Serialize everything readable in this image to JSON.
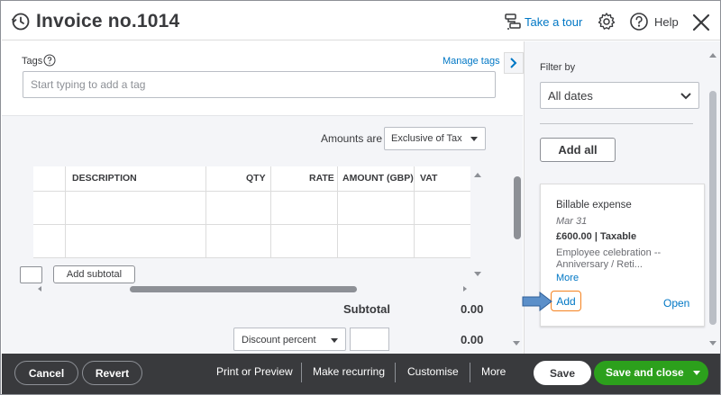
{
  "header": {
    "title": "Invoice no.1014",
    "tour_label": "Take a tour",
    "help_label": "Help"
  },
  "tags": {
    "label": "Tags",
    "manage_label": "Manage tags",
    "placeholder": "Start typing to add a tag"
  },
  "amounts": {
    "label": "Amounts are",
    "selected": "Exclusive of Tax"
  },
  "table": {
    "columns": [
      "DESCRIPTION",
      "QTY",
      "RATE",
      "AMOUNT (GBP)",
      "VAT"
    ]
  },
  "lines": {
    "add_subtotal_label": "Add subtotal"
  },
  "totals": {
    "subtotal_label": "Subtotal",
    "subtotal_value": "0.00",
    "discount_type": "Discount percent",
    "discount_value": "0.00"
  },
  "panel": {
    "filter_label": "Filter by",
    "filter_selected": "All dates",
    "add_all_label": "Add all",
    "card": {
      "title": "Billable expense",
      "date": "Mar 31",
      "amount": "£600.00 | Taxable",
      "description": "Employee celebration -- Anniversary / Reti...",
      "more_label": "More",
      "add_label": "Add",
      "open_label": "Open"
    }
  },
  "footer": {
    "cancel_label": "Cancel",
    "revert_label": "Revert",
    "print_label": "Print or Preview",
    "recurring_label": "Make recurring",
    "customise_label": "Customise",
    "more_label": "More",
    "save_label": "Save",
    "save_close_label": "Save and close"
  },
  "colors": {
    "accent_link": "#0077c5",
    "primary_green": "#2ca01c",
    "footer_bg": "#393a3d",
    "highlight_border": "#f5821f",
    "pointer_arrow": "#5b8fc9"
  }
}
